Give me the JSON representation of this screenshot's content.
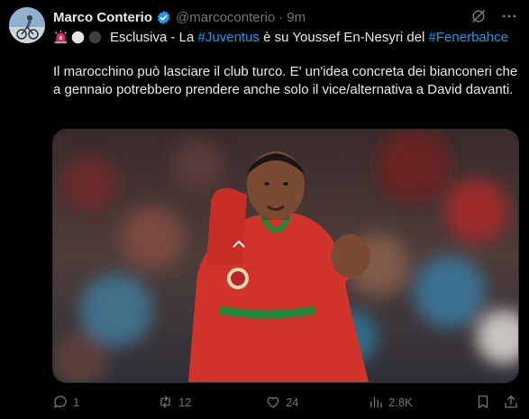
{
  "tweet": {
    "author_name": "Marco Conterio",
    "handle": "@marcoconterio",
    "separator": "·",
    "time": "9m",
    "line1": {
      "prefix": "Esclusiva - La ",
      "hashtag1": "#Juventus",
      "middle": " è su Youssef En-Nesyri del ",
      "hashtag2": "#Fenerbahce"
    },
    "body": "Il marocchino può lasciare il club turco. E' un'idea concreta dei bianconeri che a gennaio potrebbero prendere anche solo il vice/alternativa a David davanti."
  },
  "actions": {
    "replies": "1",
    "reposts": "12",
    "likes": "24",
    "views": "2.8K"
  },
  "colors": {
    "background": "#000000",
    "text": "#e7e9ea",
    "muted": "#71767b",
    "link": "#1d9bf0",
    "verified": "#1d9bf0"
  },
  "icons": [
    "verified-badge-icon",
    "grok-icon",
    "more-icon",
    "siren-emoji-icon",
    "white-circle-emoji-icon",
    "black-circle-emoji-icon",
    "reply-icon",
    "repost-icon",
    "like-icon",
    "views-icon",
    "bookmark-icon",
    "share-icon"
  ]
}
